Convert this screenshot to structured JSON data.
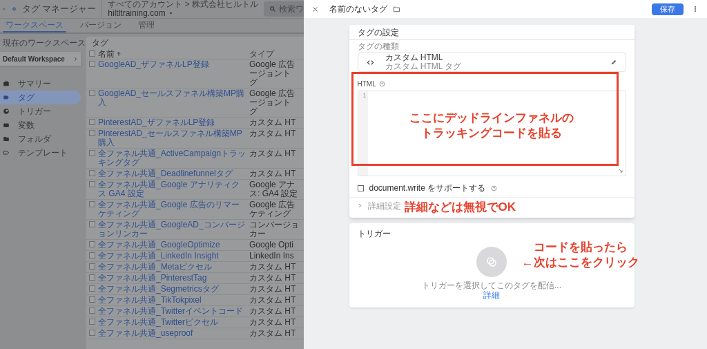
{
  "app_header": {
    "product": "タグ マネージャー",
    "breadcrumb": "すべてのアカウント > 株式会社ヒルトル",
    "account": "hiltltraining.com",
    "search_placeholder": "検索ワ"
  },
  "tabs": [
    {
      "label": "ワークスペース",
      "selected": true
    },
    {
      "label": "バージョン",
      "selected": false
    },
    {
      "label": "管理",
      "selected": false
    }
  ],
  "workspace": {
    "label": "現在のワークスペース",
    "name": "Default Workspace"
  },
  "sidebar": {
    "items": [
      {
        "label": "サマリー",
        "kind": "summary",
        "selected": false
      },
      {
        "label": "タグ",
        "kind": "tag",
        "selected": true
      },
      {
        "label": "トリガー",
        "kind": "trigger",
        "selected": false
      },
      {
        "label": "変数",
        "kind": "variable",
        "selected": false
      },
      {
        "label": "フォルダ",
        "kind": "folder",
        "selected": false
      },
      {
        "label": "テンプレート",
        "kind": "template",
        "selected": false
      }
    ]
  },
  "tags_table": {
    "title": "タグ",
    "columns": [
      "名前",
      "タイプ"
    ],
    "all_checked": false,
    "rows": [
      {
        "name": "GoogleAD_ザファネルLP登録",
        "type_lines": [
          "Google 広告",
          "ージョント",
          "グ"
        ],
        "checked": false
      },
      {
        "name": "GoogleAD_セールスファネル構築MP購入",
        "type_lines": [
          "Google 広告",
          "ージョント",
          "グ"
        ],
        "checked": false
      },
      {
        "name": "PinterestAD_ザファネルLP登録",
        "type_lines": [
          "カスタム HT"
        ],
        "checked": false
      },
      {
        "name": "PinterestAD_セールスファネル構築MP購入",
        "type_lines": [
          "カスタム HT"
        ],
        "checked": false
      },
      {
        "name": "全ファネル共通_ActiveCampaignトラッキングタグ",
        "type_lines": [
          "カスタム HT"
        ],
        "checked": false
      },
      {
        "name": "全ファネル共通_Deadlinefunnelタグ",
        "type_lines": [
          "カスタム HT"
        ],
        "checked": false
      },
      {
        "name": "全ファネル共通_Google アナリティクス GA4 設定",
        "type_lines": [
          "Google アナ",
          "ス: GA4 設定"
        ],
        "checked": false
      },
      {
        "name": "全ファネル共通_Google 広告のリマーケティング",
        "type_lines": [
          "Google 広告",
          "ケティング"
        ],
        "checked": false
      },
      {
        "name": "全ファネル共通_GoogleAD_コンバージョンリンカー",
        "type_lines": [
          "コンバージョ",
          "カー"
        ],
        "checked": false
      },
      {
        "name": "全ファネル共通_GoogleOptimize",
        "type_lines": [
          "Google Opti"
        ],
        "checked": false
      },
      {
        "name": "全ファネル共通_LinkedIn Insight",
        "type_lines": [
          "LinkedIn Ins"
        ],
        "checked": false
      },
      {
        "name": "全ファネル共通_Metaピクセル",
        "type_lines": [
          "カスタム HT"
        ],
        "checked": false
      },
      {
        "name": "全ファネル共通_PinterestTag",
        "type_lines": [
          "カスタム HT"
        ],
        "checked": false
      },
      {
        "name": "全ファネル共通_Segmetricsタグ",
        "type_lines": [
          "カスタム HT"
        ],
        "checked": false
      },
      {
        "name": "全ファネル共通_TikTokpixel",
        "type_lines": [
          "カスタム HT"
        ],
        "checked": false
      },
      {
        "name": "全ファネル共通_Twitterイベントコード",
        "type_lines": [
          "カスタム HT"
        ],
        "checked": false
      },
      {
        "name": "全ファネル共通_Twitterピクセル",
        "type_lines": [
          "カスタム HT"
        ],
        "checked": false
      },
      {
        "name": "全ファネル共通_useproof",
        "type_lines": [
          "カスタム HT"
        ],
        "checked": false
      }
    ]
  },
  "editor_panel": {
    "title": "名前のないタグ",
    "save_button": "保存",
    "tag_config": {
      "title": "タグの設定",
      "type_label": "タグの種類",
      "type_name": "カスタム HTML",
      "type_subtitle": "カスタム HTML タグ",
      "html_label": "HTML",
      "line_numbers": [
        "1"
      ],
      "document_write": {
        "label": "document.write をサポートする",
        "checked": false
      },
      "advanced": {
        "label": "詳細設定",
        "expanded": false
      }
    },
    "trigger": {
      "title": "トリガー",
      "hint": "トリガーを選択してこのタグを配信...",
      "link": "詳細"
    }
  },
  "annotations": [
    {
      "lines": [
        "ここにデッドラインファネルの",
        "トラッキングコードを貼る"
      ]
    },
    {
      "lines": [
        "詳細などは無視でOK"
      ]
    },
    {
      "lines": [
        "コードを貼ったら",
        "←次はここをクリック"
      ]
    }
  ]
}
